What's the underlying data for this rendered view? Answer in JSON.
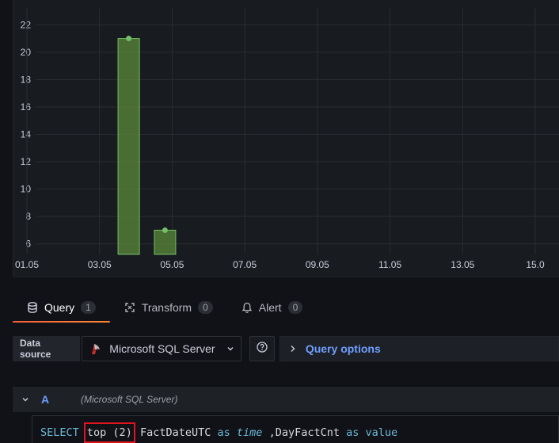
{
  "chart_data": {
    "type": "bar",
    "x_ticks": [
      "01.05",
      "03.05",
      "05.05",
      "07.05",
      "09.05",
      "11.05",
      "13.05",
      "15.0"
    ],
    "y_ticks": [
      "6",
      "8",
      "10",
      "12",
      "14",
      "16",
      "18",
      "20",
      "22"
    ],
    "series": [
      {
        "values": [
          {
            "x": "04.05",
            "y": 21
          },
          {
            "x": "05.05",
            "y": 7
          }
        ]
      }
    ],
    "ylim": [
      5,
      23
    ],
    "xlim_days": [
      1,
      15
    ],
    "grid": true,
    "colors": {
      "bar_fill": "#5a8a3a",
      "bar_stroke": "#73bf69",
      "point": "#73bf69",
      "grid": "#2a2d33",
      "tick": "#ccccdc"
    }
  },
  "tabs": [
    {
      "label": "Query",
      "count": "1",
      "icon": "database-icon",
      "active": true
    },
    {
      "label": "Transform",
      "count": "0",
      "icon": "transform-icon",
      "active": false
    },
    {
      "label": "Alert",
      "count": "0",
      "icon": "bell-icon",
      "active": false
    }
  ],
  "toolbar": {
    "datasource_label": "Data source",
    "datasource_value": "Microsoft SQL Server",
    "query_options_label": "Query options"
  },
  "query": {
    "ref_id": "A",
    "datasource_note": "(Microsoft SQL Server)",
    "sql": {
      "kw_select": "SELECT",
      "highlight": "top (2)",
      "col_time": "FactDateUTC",
      "kw_as1": "as",
      "alias_time": "time",
      "col_value": ",DayFactCnt",
      "kw_as2": "as",
      "alias_value": "value"
    }
  },
  "colors": {
    "accent": "#6e9fff",
    "tab_underline": "#f55f3e",
    "highlight_box": "#e0141c"
  }
}
